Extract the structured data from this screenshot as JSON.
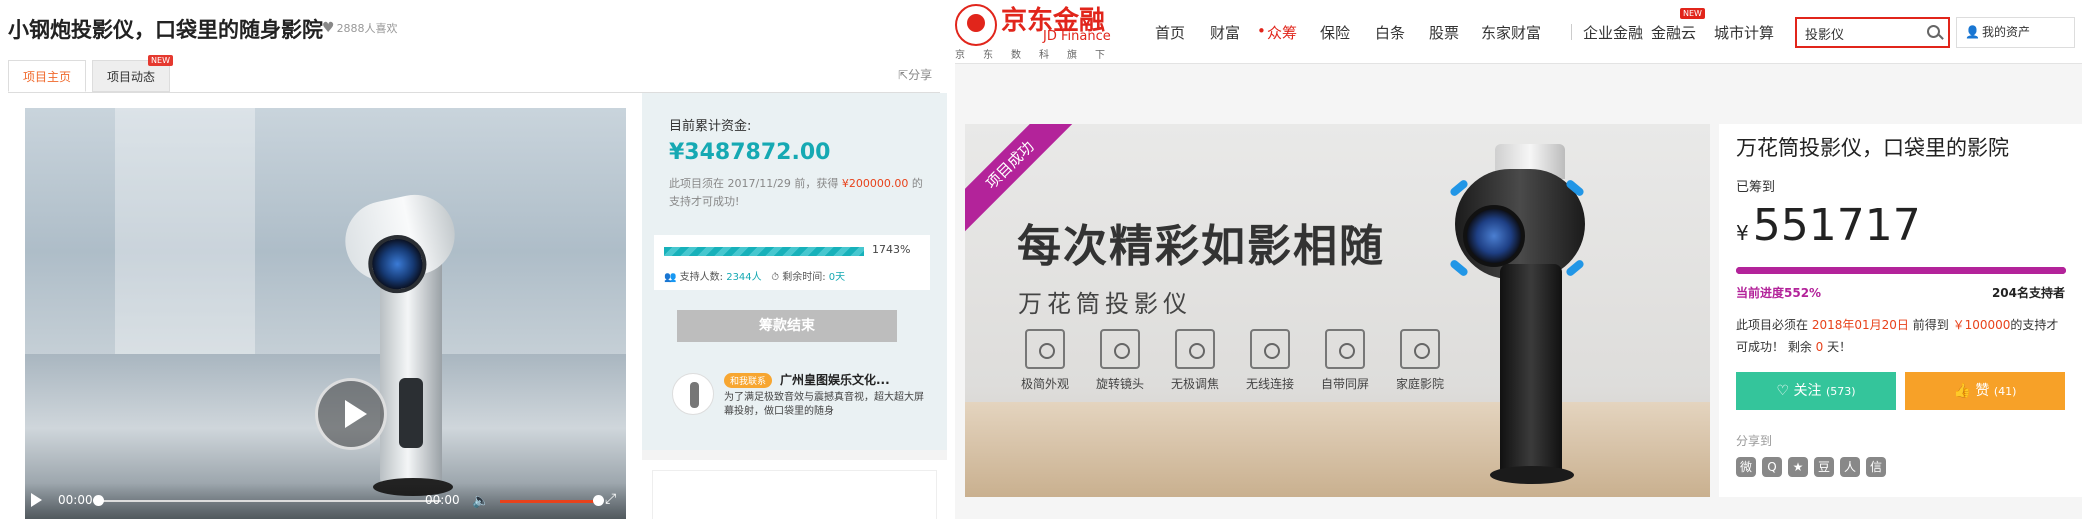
{
  "left": {
    "title": "小钢炮投影仪，口袋里的随身影院",
    "likes": "2888人喜欢",
    "tabs": [
      {
        "label": "项目主页"
      },
      {
        "label": "项目动态",
        "badge": "NEW"
      }
    ],
    "share": "分享",
    "video": {
      "current_time": "00:00",
      "duration": "00:00"
    },
    "funding": {
      "label": "目前累计资金:",
      "amount": "¥3487872.00",
      "note_pre": "此项目须在 2017/11/29 前，获得 ",
      "note_target": "¥200000.00",
      "note_post": " 的支持才可成功!"
    },
    "progress": {
      "percent_text": "1743%",
      "fill_fraction": 1.0,
      "supporters_label": "支持人数:",
      "supporters": "2344人",
      "remaining_label": "剩余时间:",
      "remaining": "0天"
    },
    "end_button": "筹款结束",
    "organizer": {
      "tag": "和我联系",
      "name": "广州皇图娱乐文化...",
      "desc": "为了满足极致音效与震撼真音视，超大超大屏幕投射，做口袋里的随身"
    }
  },
  "right": {
    "logo": {
      "cn": "京东金融",
      "en": "JD Finance",
      "sub": "京东数科旗下"
    },
    "nav": [
      {
        "label": "首页"
      },
      {
        "label": "财富"
      },
      {
        "label": "众筹"
      },
      {
        "label": "保险"
      },
      {
        "label": "白条"
      },
      {
        "label": "股票"
      },
      {
        "label": "东家财富"
      },
      {
        "label": "企业金融"
      },
      {
        "label": "金融云",
        "badge": "NEW"
      },
      {
        "label": "城市计算"
      }
    ],
    "search": {
      "value": "投影仪"
    },
    "assets": "我的资产",
    "ribbon": "项目成功",
    "hero": {
      "headline": "每次精彩如影相随",
      "subhead": "万花筒投影仪",
      "features": [
        {
          "label": "极简外观",
          "icon": "phone-icon"
        },
        {
          "label": "旋转镜头",
          "icon": "camera-icon"
        },
        {
          "label": "无极调焦",
          "icon": "slider-icon"
        },
        {
          "label": "无线连接",
          "icon": "wifi-icon"
        },
        {
          "label": "自带同屏",
          "icon": "screen-icon"
        },
        {
          "label": "家庭影院",
          "icon": "speaker-icon"
        }
      ]
    },
    "info": {
      "title": "万花筒投影仪，口袋里的影院",
      "raised_label": "已筹到",
      "currency": "¥",
      "raised": "551717",
      "progress_fraction": 1.0,
      "progress_text": "当前进度552%",
      "supporters_text": "204名支持者",
      "note_pre": "此项目必须在 ",
      "note_date": "2018年01月20日",
      "note_mid": " 前得到 ",
      "note_target": "￥100000",
      "note_post": "的支持才可成功！ 剩余 ",
      "note_days": "0",
      "note_end": " 天！",
      "follow_label": "关注",
      "follow_count": "(573)",
      "like_label": "赞",
      "like_count": "(41)",
      "share_label": "分享到"
    },
    "share_icons": [
      {
        "glyph": "微",
        "icon": "weibo-icon"
      },
      {
        "glyph": "Q",
        "icon": "qzone-icon"
      },
      {
        "glyph": "★",
        "icon": "star-icon"
      },
      {
        "glyph": "豆",
        "icon": "douban-icon"
      },
      {
        "glyph": "人",
        "icon": "renren-icon"
      },
      {
        "glyph": "信",
        "icon": "wechat-icon"
      }
    ]
  }
}
